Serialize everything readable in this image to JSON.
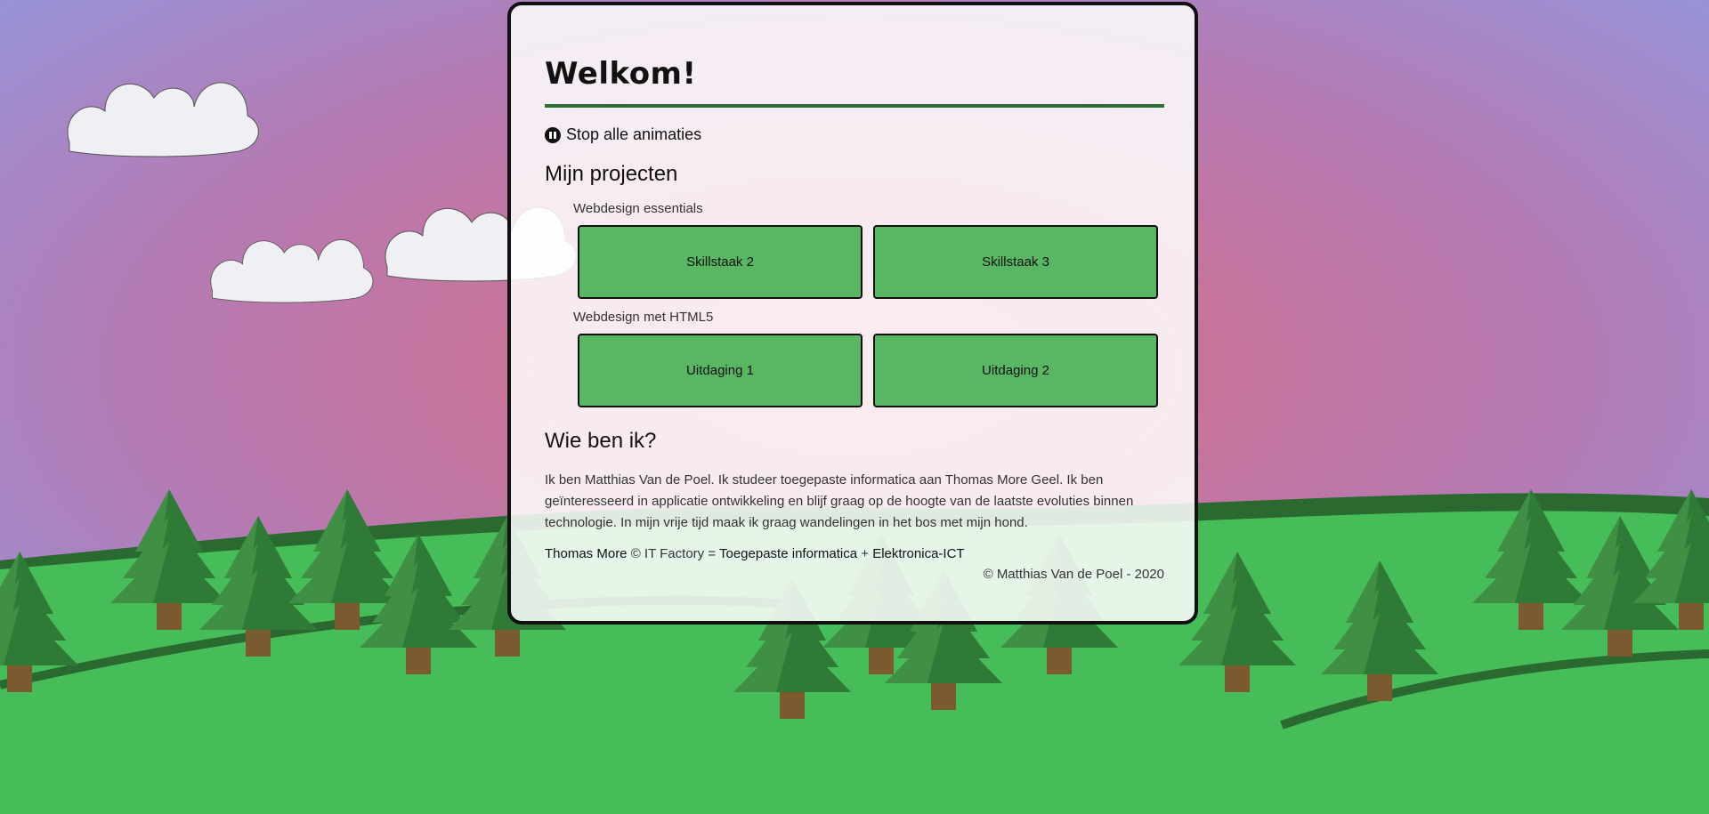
{
  "welcome": {
    "title": "Welkom!"
  },
  "controls": {
    "stop_animations": "Stop alle animaties",
    "stop_icon": "pause-circle-icon"
  },
  "projects": {
    "heading": "Mijn projecten",
    "groups": [
      {
        "label": "Webdesign essentials",
        "items": [
          "Skillstaak 2",
          "Skillstaak 3"
        ]
      },
      {
        "label": "Webdesign met HTML5",
        "items": [
          "Uitdaging 1",
          "Uitdaging 2"
        ]
      }
    ]
  },
  "about": {
    "heading": "Wie ben ik?",
    "text": "Ik ben Matthias Van de Poel. Ik studeer toegepaste informatica aan Thomas More Geel. Ik ben geïnteresseerd in applicatie ontwikkeling en blijf graag op de hoogte van de laatste evoluties binnen technologie. In mijn vrije tijd maak ik graag wandelingen in het bos met mijn hond."
  },
  "footer": {
    "link_thomas_more": "Thomas More",
    "middle": "© IT Factory =",
    "link_ti": "Toegepaste informatica",
    "plus": "+",
    "link_ict": "Elektronica-ICT",
    "copyright": "© Matthias Van de Poel - 2020"
  },
  "colors": {
    "sky_top": "#8f9be3",
    "sky_middle": "#cc7389",
    "grass": "#47bd5a",
    "tree_dark": "#2a6a30",
    "tree_light": "#3f8f45",
    "trunk": "#7a5a2e",
    "tile": "#59b763",
    "rule": "#2c6e31"
  }
}
